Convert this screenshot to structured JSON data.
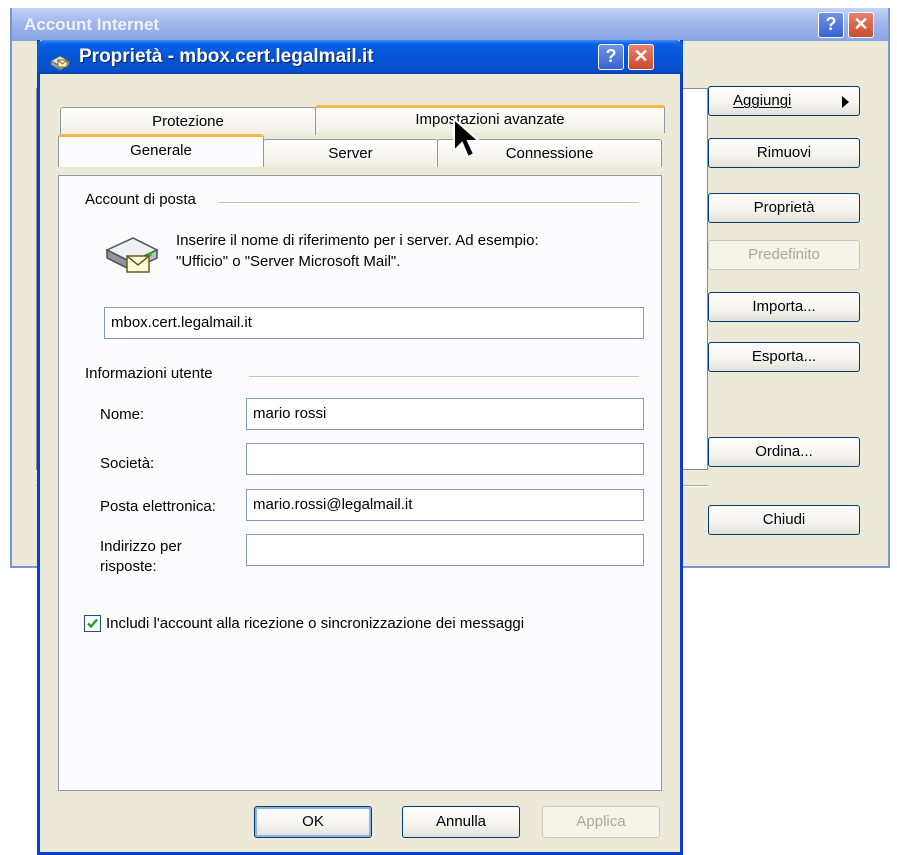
{
  "bg_window": {
    "title": "Account Internet",
    "help_glyph": "?",
    "close_glyph": "✕",
    "buttons": {
      "add": "Aggiungi",
      "remove": "Rimuovi",
      "properties": "Proprietà",
      "default": "Predefinito",
      "import": "Importa...",
      "export": "Esporta...",
      "order": "Ordina...",
      "close": "Chiudi"
    }
  },
  "dialog": {
    "title": "Proprietà - mbox.cert.legalmail.it",
    "help_glyph": "?",
    "close_glyph": "✕",
    "tabs": {
      "protection": "Protezione",
      "advanced": "Impostazioni avanzate",
      "general": "Generale",
      "server": "Server",
      "connection": "Connessione"
    },
    "mail_account": {
      "group_label": "Account di posta",
      "hint_line1": "Inserire il nome di riferimento per i server. Ad esempio:",
      "hint_line2": "\"Ufficio\" o \"Server Microsoft Mail\".",
      "account_name": "mbox.cert.legalmail.it"
    },
    "user_info": {
      "group_label": "Informazioni utente",
      "name_label": "Nome:",
      "name_value": "mario rossi",
      "company_label": "Società:",
      "company_value": "",
      "email_label": "Posta elettronica:",
      "email_value": "mario.rossi@legalmail.it",
      "reply_label_1": "Indirizzo per",
      "reply_label_2": "risposte:",
      "reply_value": ""
    },
    "include_checkbox": {
      "checked": true,
      "label": "Includi l'account alla ricezione o sincronizzazione dei messaggi"
    },
    "buttons": {
      "ok": "OK",
      "cancel": "Annulla",
      "apply": "Applica"
    }
  },
  "colors": {
    "xp_blue": "#0553d4",
    "tab_hot": "#f7b64b",
    "checkmark": "#21a121",
    "dialog_face": "#ece9d8"
  }
}
